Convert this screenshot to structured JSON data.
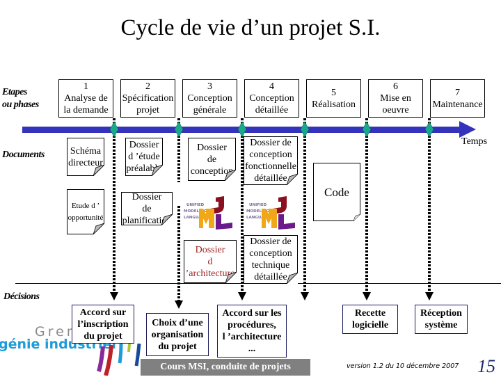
{
  "title": "Cycle de vie d’un projet S.I.",
  "row_labels": {
    "phases": [
      "Etapes",
      "ou phases"
    ],
    "documents": "Documents",
    "decisions": "Décisions"
  },
  "timeline": {
    "label": "Temps",
    "color": "#3333bb",
    "milestone_color": "#1aa88a"
  },
  "phases": [
    {
      "number": "1",
      "lines": [
        "Analyse de",
        "la demande"
      ]
    },
    {
      "number": "2",
      "lines": [
        "Spécification",
        "projet"
      ]
    },
    {
      "number": "3",
      "lines": [
        "Conception",
        "générale"
      ]
    },
    {
      "number": "4",
      "lines": [
        "Conception",
        "détaillée"
      ]
    },
    {
      "number": "5",
      "lines": [
        "Réalisation"
      ]
    },
    {
      "number": "6",
      "lines": [
        "Mise en",
        "oeuvre"
      ]
    },
    {
      "number": "7",
      "lines": [
        "Maintenance"
      ]
    }
  ],
  "documents": [
    {
      "lines": [
        "Schéma",
        "directeur"
      ]
    },
    {
      "lines": [
        "Etude d ’",
        "opportunité"
      ]
    },
    {
      "lines": [
        "Dossier",
        "d ’étude",
        "préalable"
      ]
    },
    {
      "lines": [
        "Dossier",
        "de",
        "planification"
      ]
    },
    {
      "lines": [
        "Dossier",
        "de",
        "conception"
      ]
    },
    {
      "lines": [
        "Dossier de",
        "conception",
        "fonctionnelle",
        "détaillée"
      ]
    },
    {
      "lines": [
        "Dossier",
        "d ’architecture"
      ],
      "color": "#a02020"
    },
    {
      "lines": [
        "Dossier de",
        "conception",
        "technique",
        "détaillée"
      ]
    },
    {
      "lines": [
        "Code"
      ]
    }
  ],
  "uml_logo": {
    "text_lines": [
      "UNIFIED",
      "MODELING",
      "LANGUAGE"
    ],
    "letters": [
      "U",
      "M",
      "L"
    ],
    "colors": {
      "U": "#8a1020",
      "M": "#f0a818",
      "L": "#6a1a8a"
    }
  },
  "decisions": [
    {
      "lines": [
        "Accord sur",
        "l’inscription",
        "du projet"
      ]
    },
    {
      "lines": [
        "Choix d’une",
        "organisation",
        "du projet"
      ]
    },
    {
      "lines": [
        "Accord sur les",
        "procédures,",
        "l ’architecture",
        "..."
      ]
    },
    {
      "lines": [
        "Recette",
        "logicielle"
      ]
    },
    {
      "lines": [
        "Réception",
        "système"
      ]
    }
  ],
  "footer": {
    "course": "Cours MSI, conduite de projets",
    "version": "version 1.2 du 10 décembre 2007",
    "page_number": "15",
    "logo_line1": "Greno",
    "logo_line2": "génie industriel"
  }
}
